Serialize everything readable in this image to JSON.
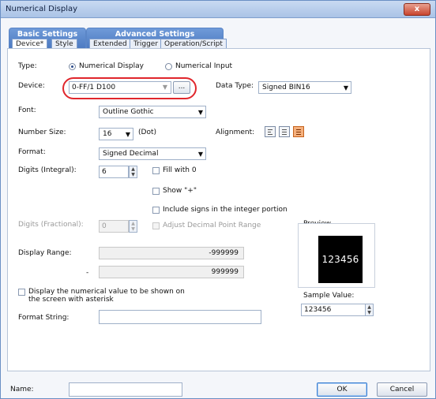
{
  "window": {
    "title": "Numerical Display",
    "close_label": "x"
  },
  "tabs": {
    "group1_label": "Basic Settings",
    "group2_label": "Advanced Settings",
    "items": [
      "Device*",
      "Style",
      "Extended",
      "Trigger",
      "Operation/Script"
    ]
  },
  "type": {
    "label": "Type:",
    "option1": "Numerical Display",
    "option2": "Numerical Input",
    "selected": "Numerical Display"
  },
  "device": {
    "label": "Device:",
    "value": "0-FF/1 D100",
    "browse_label": "..."
  },
  "data_type": {
    "label": "Data Type:",
    "value": "Signed BIN16"
  },
  "font": {
    "label": "Font:",
    "value": "Outline Gothic"
  },
  "number_size": {
    "label": "Number Size:",
    "value": "16",
    "unit": "(Dot)"
  },
  "alignment": {
    "label": "Alignment:",
    "selected": "right"
  },
  "format": {
    "label": "Format:",
    "value": "Signed Decimal"
  },
  "digits_integral": {
    "label": "Digits (Integral):",
    "value": "6"
  },
  "fill_zero": {
    "label": "Fill with 0",
    "checked": false
  },
  "show_plus": {
    "label": "Show \"+\"",
    "checked": false
  },
  "include_signs": {
    "label": "Include signs in the integer portion",
    "checked": false
  },
  "digits_fractional": {
    "label": "Digits (Fractional):",
    "value": "0"
  },
  "adjust_decimal": {
    "label": "Adjust Decimal Point Range",
    "checked": false
  },
  "display_range": {
    "label": "Display Range:",
    "min": "-999999",
    "dash": "-",
    "max": "999999"
  },
  "asterisk": {
    "line1": "Display the numerical value to be shown on",
    "line2": "the screen with asterisk",
    "checked": false
  },
  "format_string": {
    "label": "Format String:",
    "value": ""
  },
  "preview": {
    "label": "Preview",
    "display_value": "123456"
  },
  "sample_value": {
    "label": "Sample Value:",
    "value": "123456"
  },
  "footer": {
    "name_label": "Name:",
    "name_value": "",
    "ok_label": "OK",
    "cancel_label": "Cancel"
  },
  "colors": {
    "highlight": "#e0262c",
    "tab_blue": "#4a78c0",
    "align_active": "#f5b07d"
  }
}
